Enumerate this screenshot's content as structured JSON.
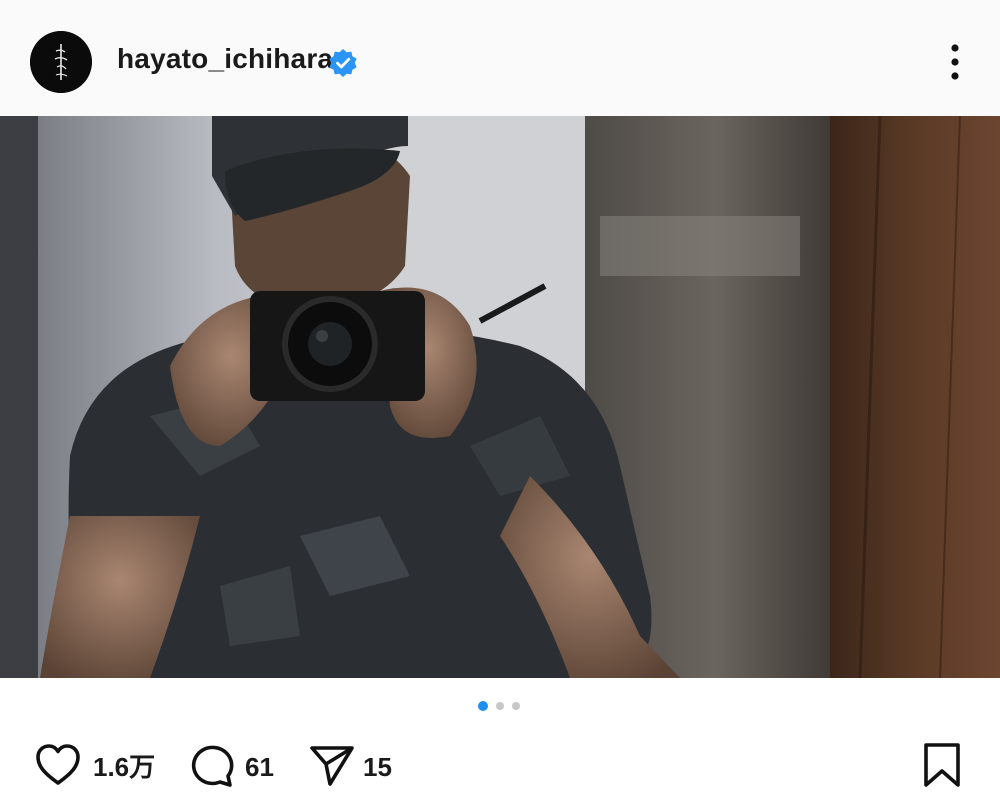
{
  "post": {
    "username": "hayato_ichihara",
    "verified": true,
    "avatar_icon": "calligraphy-logo-icon",
    "more_icon": "more-options-icon",
    "photo_description_icon": "post-photo"
  },
  "carousel": {
    "total": 3,
    "active_index": 0,
    "active_color": "#1f8fef",
    "inactive_color": "#c8c8c8"
  },
  "actions": {
    "likes": "1.6万",
    "comments": "61",
    "shares": "15"
  },
  "colors": {
    "verified_badge": "#2b95f6",
    "header_bg": "#fafafa"
  }
}
